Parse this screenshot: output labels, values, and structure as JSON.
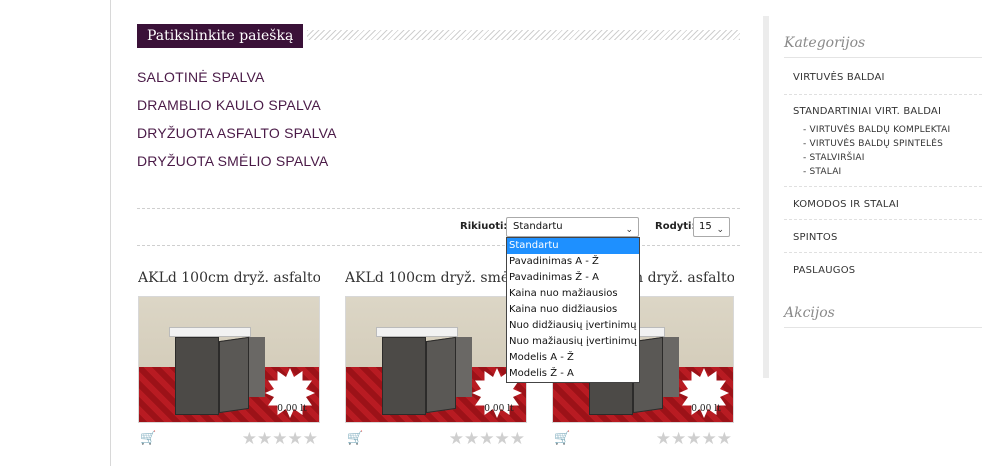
{
  "search": {
    "title": "Patikslinkite paiešką",
    "filters": [
      "SALOTINĖ SPALVA",
      "DRAMBLIO KAULO SPALVA",
      "DRYŽUOTA ASFALTO SPALVA",
      "DRYŽUOTA SMĖLIO SPALVA"
    ]
  },
  "sortbar": {
    "sort_label": "Rikiuoti:",
    "sort_value": "Standartu",
    "show_label": "Rodyti:",
    "show_value": "15",
    "sort_options": [
      "Standartu",
      "Pavadinimas A - Ž",
      "Pavadinimas Ž - A",
      "Kaina nuo mažiausios",
      "Kaina nuo didžiausios",
      "Nuo didžiausių įvertinimų",
      "Nuo mažiausių įvertinimų",
      "Modelis A - Ž",
      "Modelis Ž - A"
    ],
    "selected_index": 0
  },
  "products": [
    {
      "name": "AKLd 100cm dryž. asfalto",
      "price": "0.00 lt",
      "rating": 0
    },
    {
      "name": "AKLd 100cm dryž. smėlio",
      "price": "0.00 lt",
      "rating": 0
    },
    {
      "name": "AKLd 100cm dryž. asfalto",
      "price": "0.00 lt",
      "rating": 0
    }
  ],
  "sidebar": {
    "categories_title": "Kategorijos",
    "items": [
      {
        "label": "VIRTUVĖS BALDAI"
      },
      {
        "label": "STANDARTINIAI VIRT. BALDAI",
        "subs": [
          "- VIRTUVĖS BALDŲ KOMPLEKTAI",
          "- VIRTUVĖS BALDŲ SPINTELĖS",
          "- STALVIRŠIAI",
          "- STALAI"
        ]
      },
      {
        "label": "KOMODOS IR STALAI"
      },
      {
        "label": "SPINTOS"
      },
      {
        "label": "PASLAUGOS"
      }
    ],
    "promo_title": "Akcijos"
  },
  "colors": {
    "brand": "#3a1138",
    "link": "#4a1a47",
    "highlight": "#1e90ff",
    "floor": "#b81b22"
  },
  "icons": {
    "cart": "cart-icon",
    "star": "star-icon",
    "chevron": "chevron-down-icon"
  }
}
